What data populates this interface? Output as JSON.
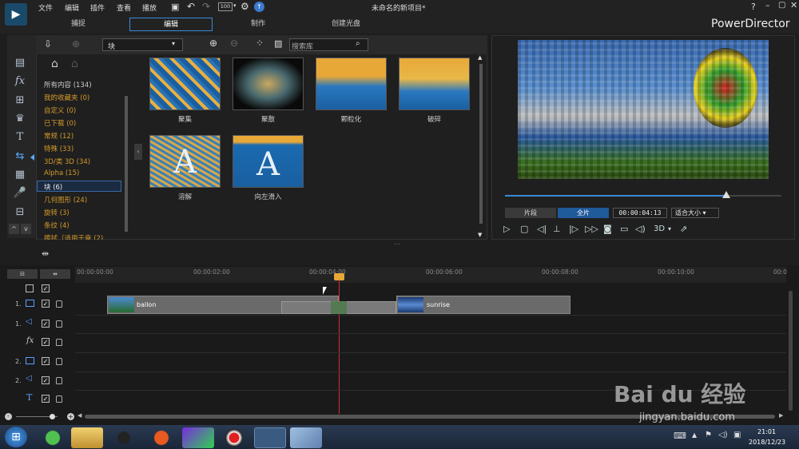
{
  "app": {
    "title": "未命名的新项目*",
    "brand": "PowerDirector",
    "help": "?"
  },
  "menu": [
    "文件",
    "编辑",
    "插件",
    "查看",
    "播放"
  ],
  "toolbar": {
    "zoom": "100"
  },
  "tabs": [
    "捕捉",
    "编辑",
    "制作",
    "创建光盘"
  ],
  "library": {
    "category": "块",
    "search_placeholder": "搜索库"
  },
  "categories": [
    {
      "label": "所有内容 (134)"
    },
    {
      "label": "我的收藏夹 (0)"
    },
    {
      "label": "自定义 (0)"
    },
    {
      "label": "已下载 (0)"
    },
    {
      "label": "常规 (12)"
    },
    {
      "label": "特殊 (33)"
    },
    {
      "label": "3D/类 3D (34)"
    },
    {
      "label": "Alpha (15)"
    },
    {
      "label": "块 (6)"
    },
    {
      "label": "几何图形 (24)"
    },
    {
      "label": "旋转 (3)"
    },
    {
      "label": "条纹 (4)"
    },
    {
      "label": "擦拭（适用于章 (2)"
    }
  ],
  "transitions": [
    {
      "label": "聚集"
    },
    {
      "label": "聚散"
    },
    {
      "label": "颗粒化"
    },
    {
      "label": "破碎"
    },
    {
      "label": "溶解"
    },
    {
      "label": "向左滑入"
    }
  ],
  "preview": {
    "clip_label": "片段",
    "full_label": "全片",
    "timecode": "00:00:04:13",
    "fit": "适合大小",
    "threeD": "3D",
    "progress": 0.8
  },
  "timeline": {
    "ruler": [
      "00:00:00:00",
      "00:00:02:00",
      "00:00:04:00",
      "00:00:06:00",
      "00:00:08:00",
      "00:00:10:00",
      "00:0"
    ],
    "tracks": [
      "1.",
      "1.",
      "",
      "2.",
      "2.",
      ""
    ],
    "clips": [
      {
        "name": "ballon"
      },
      {
        "name": "sunrise"
      }
    ]
  },
  "taskbar": {
    "time": "21:01",
    "date": "2018/12/23"
  },
  "watermark": {
    "brand": "Bai du 经验",
    "url": "jingyan.baidu.com"
  }
}
